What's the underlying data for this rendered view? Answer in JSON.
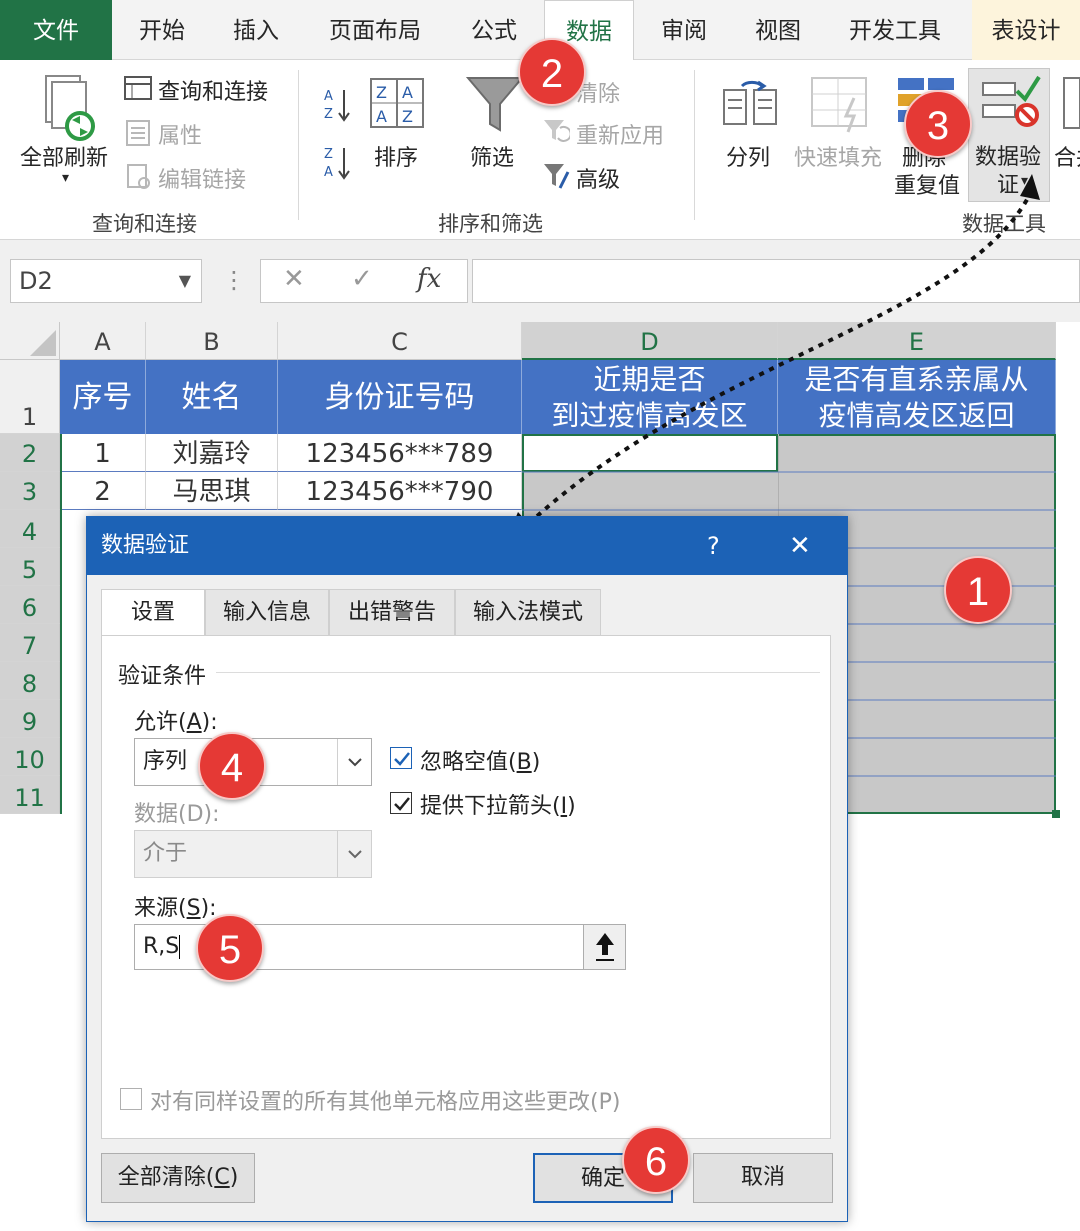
{
  "ribbon_tabs": {
    "file": "文件",
    "home": "开始",
    "insert": "插入",
    "layout": "页面布局",
    "formulas": "公式",
    "data": "数据",
    "review": "审阅",
    "view": "视图",
    "developer": "开发工具",
    "table_design": "表设计"
  },
  "ribbon": {
    "refresh_all": "全部刷新",
    "queries_connections": "查询和连接",
    "properties": "属性",
    "edit_links": "编辑链接",
    "group_queries": "查询和连接",
    "sort": "排序",
    "filter": "筛选",
    "clear": "清除",
    "reapply": "重新应用",
    "advanced": "高级",
    "group_sort_filter": "排序和筛选",
    "text_to_columns": "分列",
    "flash_fill": "快速填充",
    "remove_dup_1": "删除",
    "remove_dup_2": "重复值",
    "data_validation_1": "数据验",
    "data_validation_2": "证",
    "consolidate": "合并",
    "group_data_tools": "数据工具"
  },
  "formula_bar": {
    "name_box": "D2",
    "fx": "fx",
    "cancel": "✕",
    "enter": "✓",
    "formula": ""
  },
  "columns": [
    "A",
    "B",
    "C",
    "D",
    "E"
  ],
  "rows": [
    "1",
    "2",
    "3",
    "4",
    "5",
    "6",
    "7",
    "8",
    "9",
    "10",
    "11"
  ],
  "table": {
    "headers": [
      "序号",
      "姓名",
      "身份证号码",
      "近期是否\n到过疫情高发区",
      "是否有直系亲属从\n疫情高发区返回"
    ],
    "row2": [
      "1",
      "刘嘉玲",
      "123456***789"
    ],
    "row3": [
      "2",
      "马思琪",
      "123456***790"
    ]
  },
  "dialog": {
    "title": "数据验证",
    "help": "?",
    "close": "✕",
    "tabs": [
      "设置",
      "输入信息",
      "出错警告",
      "输入法模式"
    ],
    "section": "验证条件",
    "allow_label": "允许(",
    "allow_key": "A",
    "allow_end": "):",
    "allow_value": "序列",
    "ignore_blank": "忽略空值(",
    "ignore_blank_key": "B",
    "in_cell_dropdown": "提供下拉箭头(",
    "in_cell_dropdown_key": "I",
    "close_paren": ")",
    "data_label": "数据(D):",
    "data_value": "介于",
    "source_label": "来源(",
    "source_key": "S",
    "source_value": "R,S",
    "apply_all": "对有同样设置的所有其他单元格应用这些更改(P)",
    "clear_all": "全部清除(",
    "clear_all_key": "C",
    "ok": "确定",
    "cancel": "取消"
  },
  "badges": [
    "1",
    "2",
    "3",
    "4",
    "5",
    "6"
  ],
  "colors": {
    "excel_green": "#217346",
    "header_blue": "#4472c4",
    "dialog_blue": "#1c62b6",
    "badge_red": "#e53935",
    "selection_gray": "#c8c8c8"
  }
}
